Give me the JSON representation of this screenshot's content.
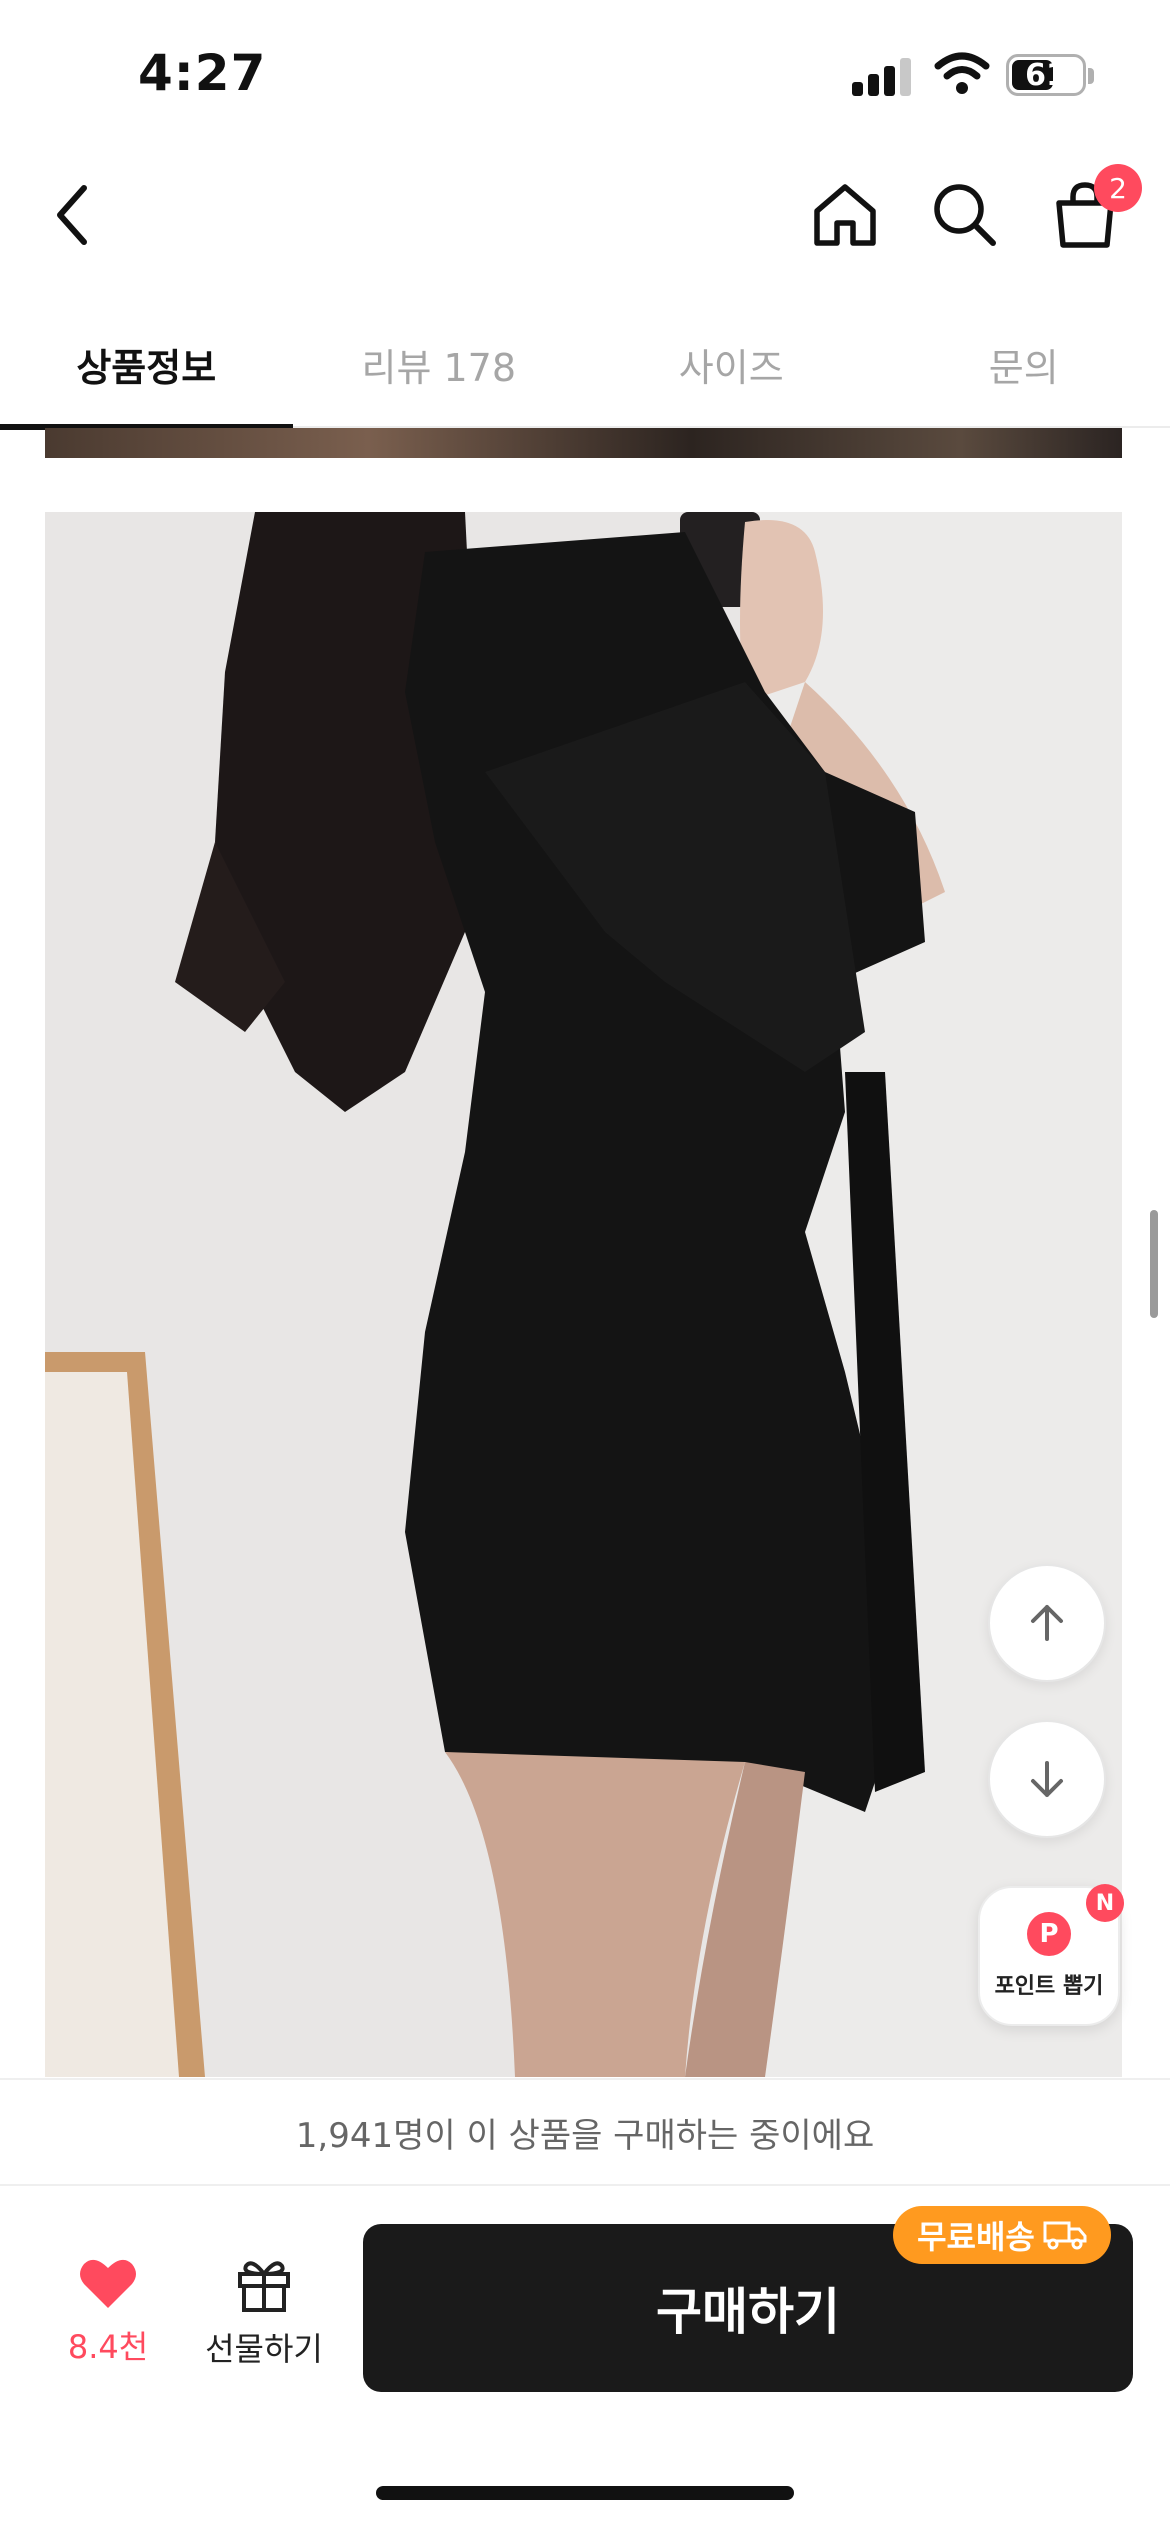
{
  "status_bar": {
    "time": "4:27",
    "battery_level": "61",
    "battery_fraction": 0.61
  },
  "nav": {
    "cart_badge": "2"
  },
  "tabs": [
    {
      "label": "상품정보",
      "active": true
    },
    {
      "label": "리뷰 178",
      "active": false
    },
    {
      "label": "사이즈",
      "active": false
    },
    {
      "label": "문의",
      "active": false
    }
  ],
  "floating": {
    "points_label": "포인트 뽑기",
    "points_icon_letter": "P",
    "points_badge": "N"
  },
  "buying_banner": "1,941명이 이 상품을 구매하는 중이에요",
  "bottom_bar": {
    "like_count": "8.4천",
    "gift_label": "선물하기",
    "buy_label": "구매하기",
    "free_shipping_label": "무료배송"
  },
  "colors": {
    "accent_red": "#ff4a5e",
    "buy_button": "#1a1a1a",
    "free_shipping": "#ff9a1f"
  },
  "icons": [
    "back-icon",
    "home-icon",
    "search-icon",
    "cart-icon",
    "arrow-up-icon",
    "arrow-down-icon",
    "heart-icon",
    "gift-icon",
    "truck-icon"
  ]
}
